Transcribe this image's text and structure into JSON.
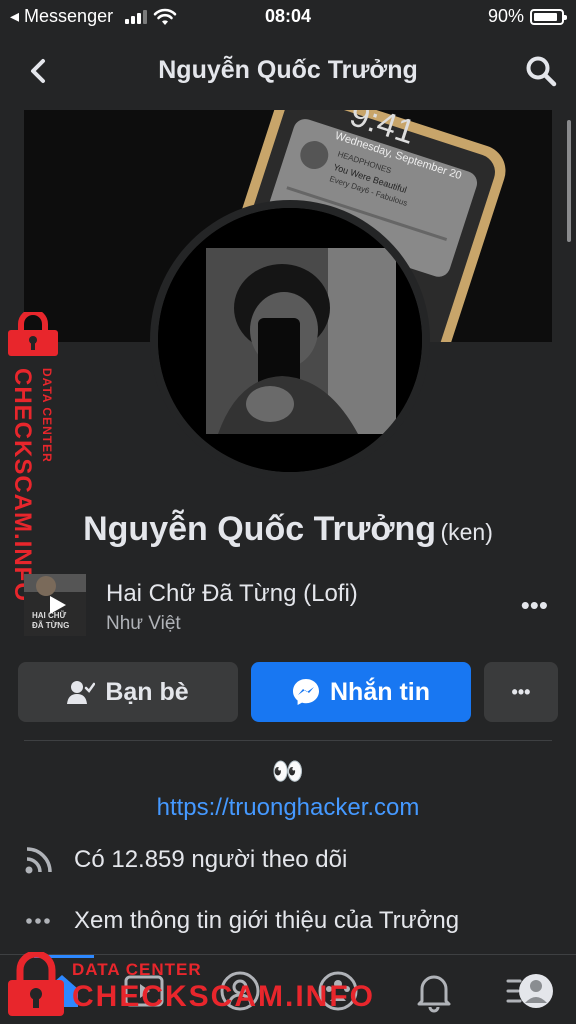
{
  "status_bar": {
    "carrier": "◂ Messenger",
    "time": "08:04",
    "battery_text": "90%",
    "battery_level": 0.9
  },
  "nav": {
    "title": "Nguyễn Quốc Trưởng",
    "back_icon": "chevron-left-icon",
    "search_icon": "search-icon"
  },
  "profile": {
    "name": "Nguyễn Quốc Trưởng",
    "alt_name": "(ken)"
  },
  "song": {
    "title": "Hai Chữ Đã Từng (Lofi)",
    "artist": "Như Việt",
    "thumb_text_1": "HAI CHỮ",
    "thumb_text_2": "ĐÃ TỪNG",
    "more_label": "•••"
  },
  "actions": {
    "friends_label": "Bạn bè",
    "message_label": "Nhắn tin",
    "more_label": "•••"
  },
  "bio": {
    "emoji": "👀",
    "link": "https://truonghacker.com"
  },
  "info": {
    "followers": "Có 12.859 người theo dõi",
    "about": "Xem thông tin giới thiệu của Trưởng"
  },
  "cover_text": {
    "clock": "9:41",
    "date": "Wednesday, September 20",
    "app": "HEADPHONES",
    "song_title": "You Were Beautiful",
    "song_sub": "Every Day6 - Fabulous"
  },
  "watermark": {
    "brand": "CHECKSCAM.INFO",
    "sub": "DATA CENTER"
  },
  "colors": {
    "background": "#242526",
    "accent": "#1877f2",
    "link": "#4599ff",
    "watermark": "#e8262c"
  }
}
